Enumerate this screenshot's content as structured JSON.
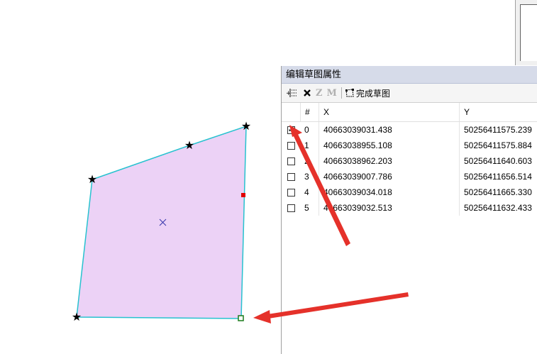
{
  "panel": {
    "title": "编辑草图属性",
    "toolbar": {
      "z_label": "Z",
      "m_label": "M",
      "finish_label": "完成草图"
    },
    "columns": [
      "#",
      "X",
      "Y"
    ],
    "rows": [
      {
        "checked": true,
        "index": "0",
        "x": "40663039031.438",
        "y": "50256411575.239"
      },
      {
        "checked": false,
        "index": "1",
        "x": "40663038955.108",
        "y": "50256411575.884"
      },
      {
        "checked": false,
        "index": "2",
        "x": "40663038962.203",
        "y": "50256411640.603"
      },
      {
        "checked": false,
        "index": "3",
        "x": "40663039007.786",
        "y": "50256411656.514"
      },
      {
        "checked": false,
        "index": "4",
        "x": "40663039034.018",
        "y": "50256411665.330"
      },
      {
        "checked": false,
        "index": "5",
        "x": "40663039032.513",
        "y": "50256411632.433"
      }
    ]
  },
  "colors": {
    "polygon_fill": "#ecd2f6",
    "polygon_edge": "#27c2cf",
    "vertex": "#000000",
    "selected_vertex": "#1a7a1a",
    "midpoint": "#e00000",
    "arrow": "#e5312a"
  },
  "icons": {
    "insert": "insert-vertex-icon",
    "delete": "delete-icon",
    "finish": "finish-sketch-icon"
  }
}
